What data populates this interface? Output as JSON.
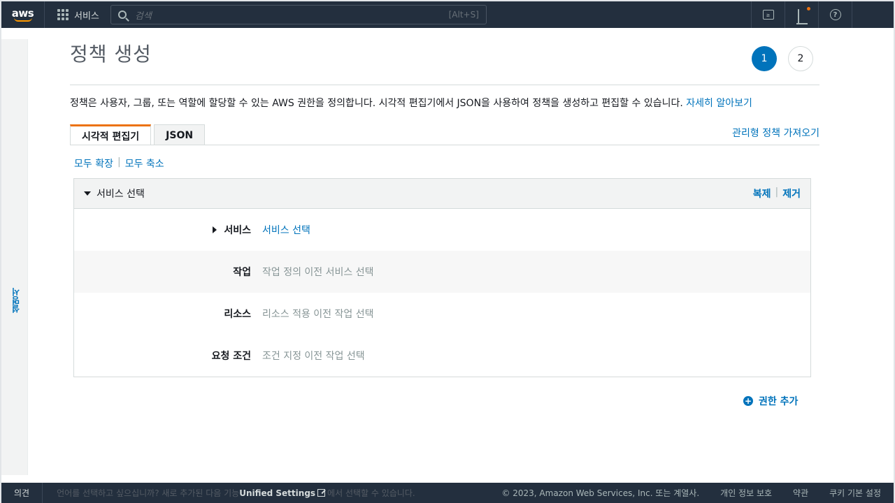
{
  "topnav": {
    "logo": "aws",
    "services_label": "서비스",
    "search_placeholder": "검색",
    "search_shortcut": "[Alt+S]",
    "cloudshell_glyph": "≥"
  },
  "tools_rail": {
    "label": "설명서"
  },
  "page": {
    "title": "정책 생성",
    "steps": [
      "1",
      "2"
    ],
    "description": "정책은 사용자, 그룹, 또는 역할에 할당할 수 있는 AWS 권한을 정의합니다. 시각적 편집기에서 JSON을 사용하여 정책을 생성하고 편집할 수 있습니다.",
    "learn_more": "자세히 알아보기",
    "tabs": [
      {
        "label": "시각적 편집기",
        "active": true
      },
      {
        "label": "JSON",
        "active": false
      }
    ],
    "import_link": "관리형 정책 가져오기",
    "expand_all": "모두 확장",
    "collapse_all": "모두 축소",
    "separator": "|"
  },
  "panel": {
    "title": "서비스 선택",
    "clone": "복제",
    "remove": "제거",
    "rows": [
      {
        "label": "서비스",
        "value": "서비스 선택"
      },
      {
        "label": "작업",
        "value": "작업 정의 이전 서비스 선택"
      },
      {
        "label": "리소스",
        "value": "리소스 적용 이전 작업 선택"
      },
      {
        "label": "요청 조건",
        "value": "조건 지정 이전 작업 선택"
      }
    ]
  },
  "add_permission": "권한 추가",
  "footer": {
    "feedback": "의견",
    "lang_text_1": "언어를 선택하고 싶으십니까? 새로 추가된 다음 기능",
    "unified_settings": "Unified Settings",
    "lang_text_2": "에서 선택할 수 있습니다.",
    "copyright": "© 2023, Amazon Web Services, Inc. 또는 계열사.",
    "privacy": "개인 정보 보호",
    "terms": "약관",
    "cookies": "쿠키 기본 설정"
  },
  "colors": {
    "nav_bg": "#232f3e",
    "link": "#0073bb",
    "tab_accent": "#ec7211",
    "text": "#16191f",
    "muted": "#879596"
  }
}
